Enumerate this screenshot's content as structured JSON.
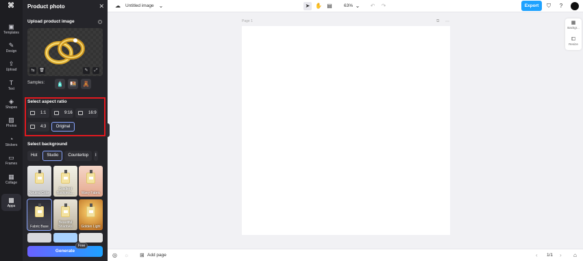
{
  "rail": {
    "logo": "⌘",
    "items": [
      {
        "label": "Templates",
        "icon": "▣"
      },
      {
        "label": "Design",
        "icon": "✎"
      },
      {
        "label": "Upload",
        "icon": "⇪"
      },
      {
        "label": "Text",
        "icon": "T"
      },
      {
        "label": "Shapes",
        "icon": "◈"
      },
      {
        "label": "Photos",
        "icon": "▨"
      },
      {
        "label": "Stickers",
        "icon": "◔"
      },
      {
        "label": "Frames",
        "icon": "▭"
      },
      {
        "label": "Collage",
        "icon": "▦"
      },
      {
        "label": "Apps",
        "icon": "▩"
      }
    ]
  },
  "panel": {
    "title": "Product photo",
    "close_icon": "✕",
    "upload_title": "Upload product image",
    "info_icon": "i",
    "upload_buttons": [
      "⇆",
      "🗑",
      "✎",
      "⤢"
    ],
    "samples_label": "Samples:",
    "samples": [
      "🧴",
      "🍱",
      "🧸"
    ],
    "aspect_title": "Select aspect ratio",
    "ratios": [
      "1:1",
      "9:16",
      "16:9",
      "4:3",
      "Original"
    ],
    "background_title": "Select background",
    "tabs": [
      "Hot",
      "Studio",
      "Countertop",
      "I"
    ],
    "backgrounds": [
      {
        "label": "Neutral Color"
      },
      {
        "label": "Gradient Backgrou..."
      },
      {
        "label": "Wavy Fabric"
      },
      {
        "label": "Fabric Base"
      },
      {
        "label": "Beautiful Shadows"
      },
      {
        "label": "Golden Light"
      }
    ],
    "free_badge": "Free",
    "generate_label": "Generate"
  },
  "topbar": {
    "doc_title": "Untitled image",
    "zoom": "63%",
    "export_label": "Export"
  },
  "canvas": {
    "page_label": "Page 1"
  },
  "right_card": {
    "items": [
      "Backgr...",
      "Resize"
    ]
  },
  "bottombar": {
    "add_page_label": "Add page",
    "page_counter": "1/1"
  },
  "colors": {
    "accent": "#1ea2ff",
    "highlight": "#e3191f",
    "panel_bg": "#25252a"
  }
}
